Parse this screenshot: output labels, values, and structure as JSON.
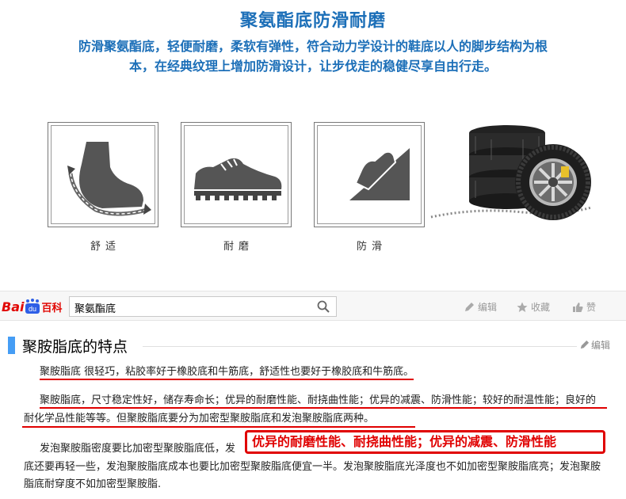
{
  "promo": {
    "title": "聚氨酯底防滑耐磨",
    "description_line1": "防滑聚氨酯底，轻便耐磨，柔软有弹性，符合动力学设计的鞋底以人的脚步结构为根",
    "description_line2": "本，在经典纹理上增加防滑设计，让步伐走的稳健尽享自由行走。",
    "features": [
      {
        "label": "舒适",
        "icon": "foot-curve-icon"
      },
      {
        "label": "耐磨",
        "icon": "shoe-sole-icon"
      },
      {
        "label": "防滑",
        "icon": "shoe-slope-icon"
      }
    ],
    "tires_image": "tires-image"
  },
  "baike": {
    "logo_bai": "Bai",
    "logo_du": "du",
    "logo_baike": "百科",
    "search_value": "聚氨酯底",
    "actions": {
      "edit": "编辑",
      "favorite": "收藏",
      "like": "赞"
    }
  },
  "article": {
    "section_title": "聚胺脂底的特点",
    "section_edit": "编辑",
    "p1": "聚胺脂底 很轻巧，粘胶率好于橡胶底和牛筋底，舒适性也要好于橡胶底和牛筋底。",
    "p2_line1": "聚胺脂底，尺寸稳定性好，储存寿命长；优异的耐磨性能、耐挠曲性能；优异的减震、防滑性能；较好的耐温性能；良好的",
    "p2_line2": "耐化学品性能等等。但聚胺脂底要分为加密型聚胺脂底和发泡聚胺脂底两种。",
    "p3_line1": "发泡聚胺脂密度要比加密型聚胺脂底低，发",
    "p3_line2": "底还要再轻一些，发泡聚胺脂底成本也要比加密型聚胺脂底便宜一半。发泡聚胺脂底光泽度也不如加密型聚胺脂底亮；发泡聚胺",
    "p3_line3": "脂底耐穿度不如加密型聚胺脂.",
    "callout": "优异的耐磨性能、耐挠曲性能；优异的减震、防滑性能"
  },
  "colors": {
    "accent_blue": "#1c6fb8",
    "baidu_red": "#e10602",
    "section_bar": "#459df5",
    "highlight_red": "#e00000"
  }
}
